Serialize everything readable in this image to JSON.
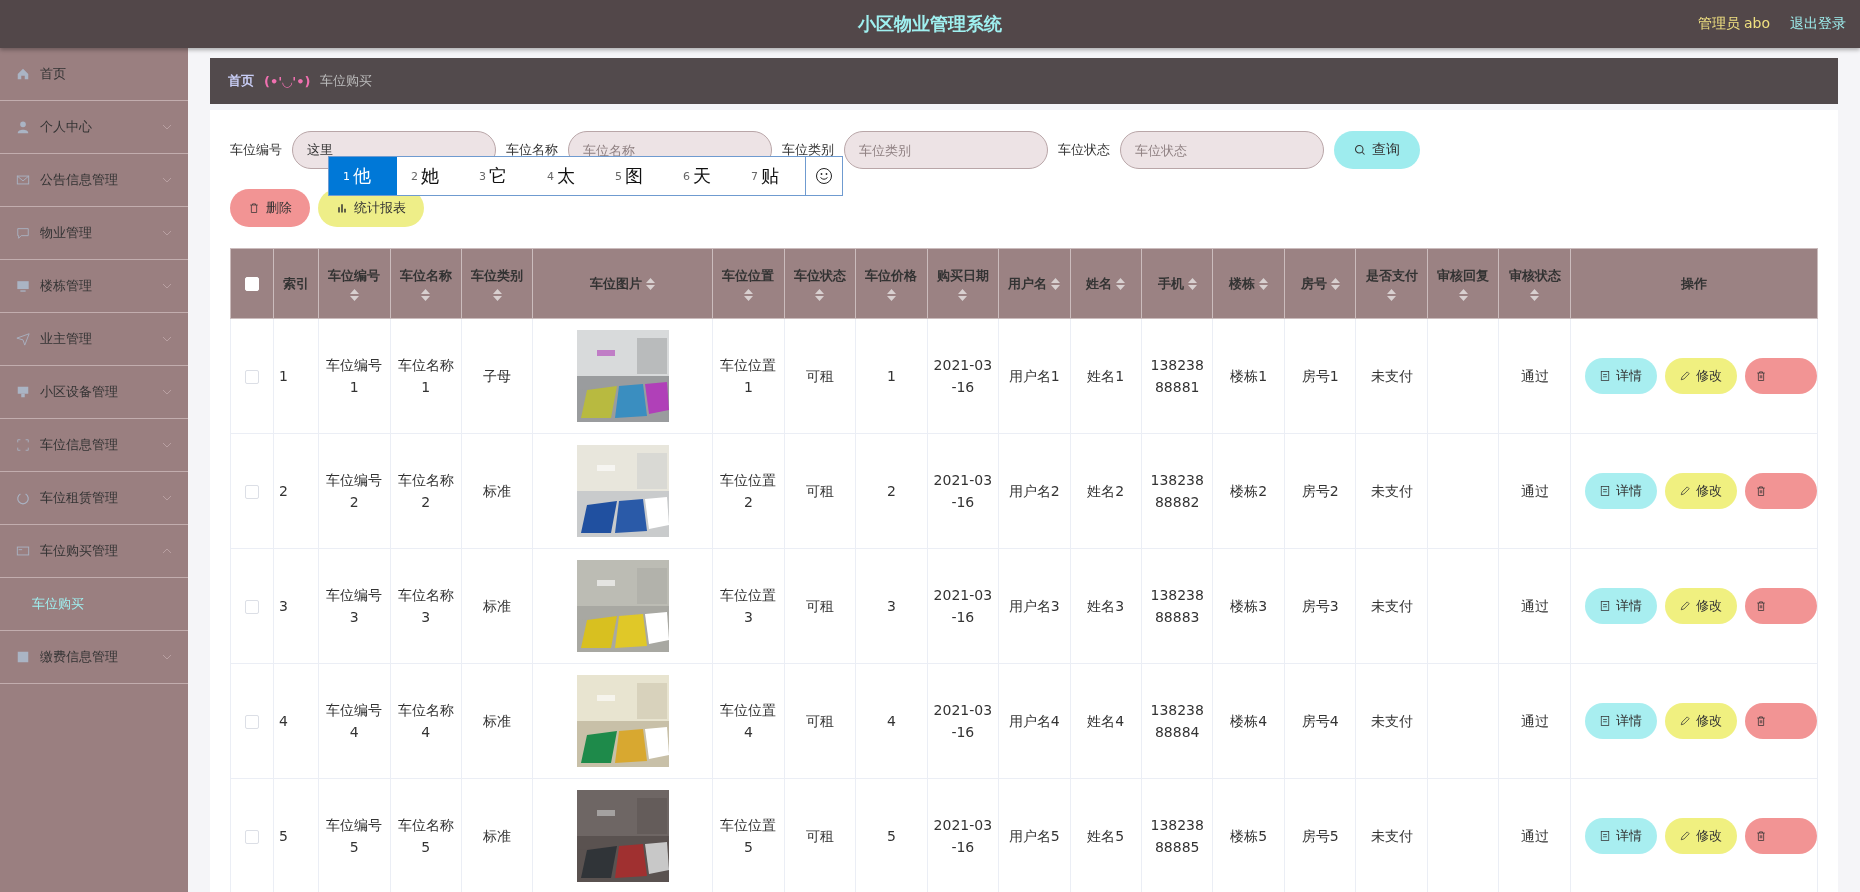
{
  "header": {
    "title": "小区物业管理系统",
    "user": "管理员 abo",
    "logout": "退出登录"
  },
  "sidebar": {
    "items": [
      {
        "label": "首页",
        "kind": "link"
      },
      {
        "label": "个人中心",
        "kind": "menu",
        "expanded": false
      },
      {
        "label": "公告信息管理",
        "kind": "menu",
        "expanded": false
      },
      {
        "label": "物业管理",
        "kind": "menu",
        "expanded": false
      },
      {
        "label": "楼栋管理",
        "kind": "menu",
        "expanded": false
      },
      {
        "label": "业主管理",
        "kind": "menu",
        "expanded": false
      },
      {
        "label": "小区设备管理",
        "kind": "menu",
        "expanded": false
      },
      {
        "label": "车位信息管理",
        "kind": "menu",
        "expanded": false
      },
      {
        "label": "车位租赁管理",
        "kind": "menu",
        "expanded": false
      },
      {
        "label": "车位购买管理",
        "kind": "menu",
        "expanded": true,
        "children": [
          {
            "label": "车位购买",
            "selected": true
          }
        ]
      },
      {
        "label": "缴费信息管理",
        "kind": "menu",
        "expanded": false
      }
    ]
  },
  "breadcrumb": {
    "home": "首页",
    "separator": "(•'◡'•)",
    "current": "车位购买"
  },
  "search": {
    "fields": [
      {
        "label": "车位编号",
        "value": "这里"
      },
      {
        "label": "车位名称",
        "placeholder": "车位名称"
      },
      {
        "label": "车位类别",
        "placeholder": "车位类别"
      },
      {
        "label": "车位状态",
        "placeholder": "车位状态"
      }
    ],
    "button": "查询"
  },
  "ime": {
    "candidates": [
      {
        "number": "1",
        "text": "他",
        "selected": true
      },
      {
        "number": "2",
        "text": "她",
        "selected": false
      },
      {
        "number": "3",
        "text": "它",
        "selected": false
      },
      {
        "number": "4",
        "text": "太",
        "selected": false
      },
      {
        "number": "5",
        "text": "图",
        "selected": false
      },
      {
        "number": "6",
        "text": "天",
        "selected": false
      },
      {
        "number": "7",
        "text": "贴",
        "selected": false
      }
    ]
  },
  "toolbar": [
    {
      "kind": "delete",
      "label": "删除"
    },
    {
      "kind": "report",
      "label": "统计报表"
    }
  ],
  "table": {
    "select_all": {
      "checked": false
    },
    "columns": [
      {
        "label": "索引",
        "kind": "text",
        "sortable": false
      },
      {
        "label": "车位编号",
        "kind": "text",
        "sortable": true
      },
      {
        "label": "车位名称",
        "kind": "text",
        "sortable": true
      },
      {
        "label": "车位类别",
        "kind": "text",
        "sortable": true
      },
      {
        "label": "车位图片",
        "kind": "picture",
        "sortable": true
      },
      {
        "label": "车位位置",
        "kind": "text",
        "sortable": true
      },
      {
        "label": "车位状态",
        "kind": "text",
        "sortable": true
      },
      {
        "label": "车位价格",
        "kind": "text",
        "sortable": true
      },
      {
        "label": "购买日期",
        "kind": "text",
        "sortable": true
      },
      {
        "label": "用户名",
        "kind": "text",
        "sortable": true
      },
      {
        "label": "姓名",
        "kind": "text",
        "sortable": true
      },
      {
        "label": "手机",
        "kind": "text",
        "sortable": true
      },
      {
        "label": "楼栋",
        "kind": "text",
        "sortable": true
      },
      {
        "label": "房号",
        "kind": "text",
        "sortable": true
      },
      {
        "label": "是否支付",
        "kind": "text",
        "sortable": true
      },
      {
        "label": "审核回复",
        "kind": "text",
        "sortable": true
      },
      {
        "label": "审核状态",
        "kind": "text",
        "sortable": true
      },
      {
        "label": "操作",
        "kind": "actions",
        "sortable": false
      }
    ],
    "rows": [
      {
        "checked": false,
        "cells": [
          "1",
          "车位编号1",
          "车位名称1",
          "子母",
          {
            "kind": "picture"
          },
          "车位位置1",
          "可租",
          "1",
          "2021-03-16",
          "用户名1",
          "姓名1",
          "13823888881",
          "楼栋1",
          "房号1",
          "未支付",
          null,
          "通过",
          [
            {
              "kind": "detail",
              "label": "详情"
            },
            {
              "kind": "edit",
              "label": "修改"
            },
            {
              "kind": "delete"
            }
          ]
        ]
      },
      {
        "checked": false,
        "cells": [
          "2",
          "车位编号2",
          "车位名称2",
          "标准",
          {
            "kind": "picture"
          },
          "车位位置2",
          "可租",
          "2",
          "2021-03-16",
          "用户名2",
          "姓名2",
          "13823888882",
          "楼栋2",
          "房号2",
          "未支付",
          null,
          "通过",
          [
            {
              "kind": "detail",
              "label": "详情"
            },
            {
              "kind": "edit",
              "label": "修改"
            },
            {
              "kind": "delete"
            }
          ]
        ]
      },
      {
        "checked": false,
        "cells": [
          "3",
          "车位编号3",
          "车位名称3",
          "标准",
          {
            "kind": "picture"
          },
          "车位位置3",
          "可租",
          "3",
          "2021-03-16",
          "用户名3",
          "姓名3",
          "13823888883",
          "楼栋3",
          "房号3",
          "未支付",
          null,
          "通过",
          [
            {
              "kind": "detail",
              "label": "详情"
            },
            {
              "kind": "edit",
              "label": "修改"
            },
            {
              "kind": "delete"
            }
          ]
        ]
      },
      {
        "checked": false,
        "cells": [
          "4",
          "车位编号4",
          "车位名称4",
          "标准",
          {
            "kind": "picture"
          },
          "车位位置4",
          "可租",
          "4",
          "2021-03-16",
          "用户名4",
          "姓名4",
          "13823888884",
          "楼栋4",
          "房号4",
          "未支付",
          null,
          "通过",
          [
            {
              "kind": "detail",
              "label": "详情"
            },
            {
              "kind": "edit",
              "label": "修改"
            },
            {
              "kind": "delete"
            }
          ]
        ]
      },
      {
        "checked": false,
        "cells": [
          "5",
          "车位编号5",
          "车位名称5",
          "标准",
          {
            "kind": "picture"
          },
          "车位位置5",
          "可租",
          "5",
          "2021-03-16",
          "用户名5",
          "姓名5",
          "13823888885",
          "楼栋5",
          "房号5",
          "未支付",
          null,
          "通过",
          [
            {
              "kind": "detail",
              "label": "详情"
            },
            {
              "kind": "edit",
              "label": "修改"
            },
            {
              "kind": "delete"
            }
          ]
        ]
      }
    ]
  }
}
